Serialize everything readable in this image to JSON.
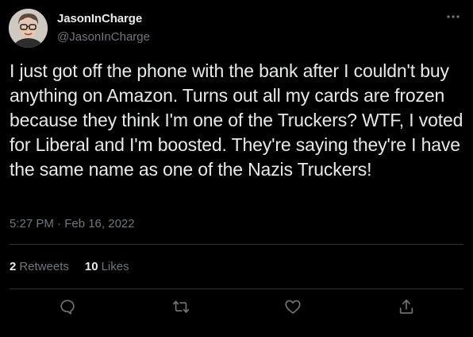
{
  "author": {
    "display_name": "JasonInCharge",
    "handle": "@JasonInCharge"
  },
  "tweet": {
    "text": "I just got off the phone with the bank after I couldn't buy anything on Amazon. Turns out all my cards are frozen because they think I'm one of the Truckers? WTF, I voted for Liberal and I'm boosted. They're saying they're I have the same name as one of the Nazis Truckers!",
    "timestamp": "5:27 PM · Feb 16, 2022"
  },
  "stats": {
    "retweets_count": "2",
    "retweets_label": "Retweets",
    "likes_count": "10",
    "likes_label": "Likes"
  },
  "actions": {
    "reply_icon": "reply-icon",
    "retweet_icon": "retweet-icon",
    "like_icon": "heart-icon",
    "share_icon": "share-icon",
    "more_icon": "more-icon"
  },
  "colors": {
    "background": "#000000",
    "primary_text": "#e7e9ea",
    "secondary_text": "#71767b",
    "divider": "#2f3336"
  }
}
